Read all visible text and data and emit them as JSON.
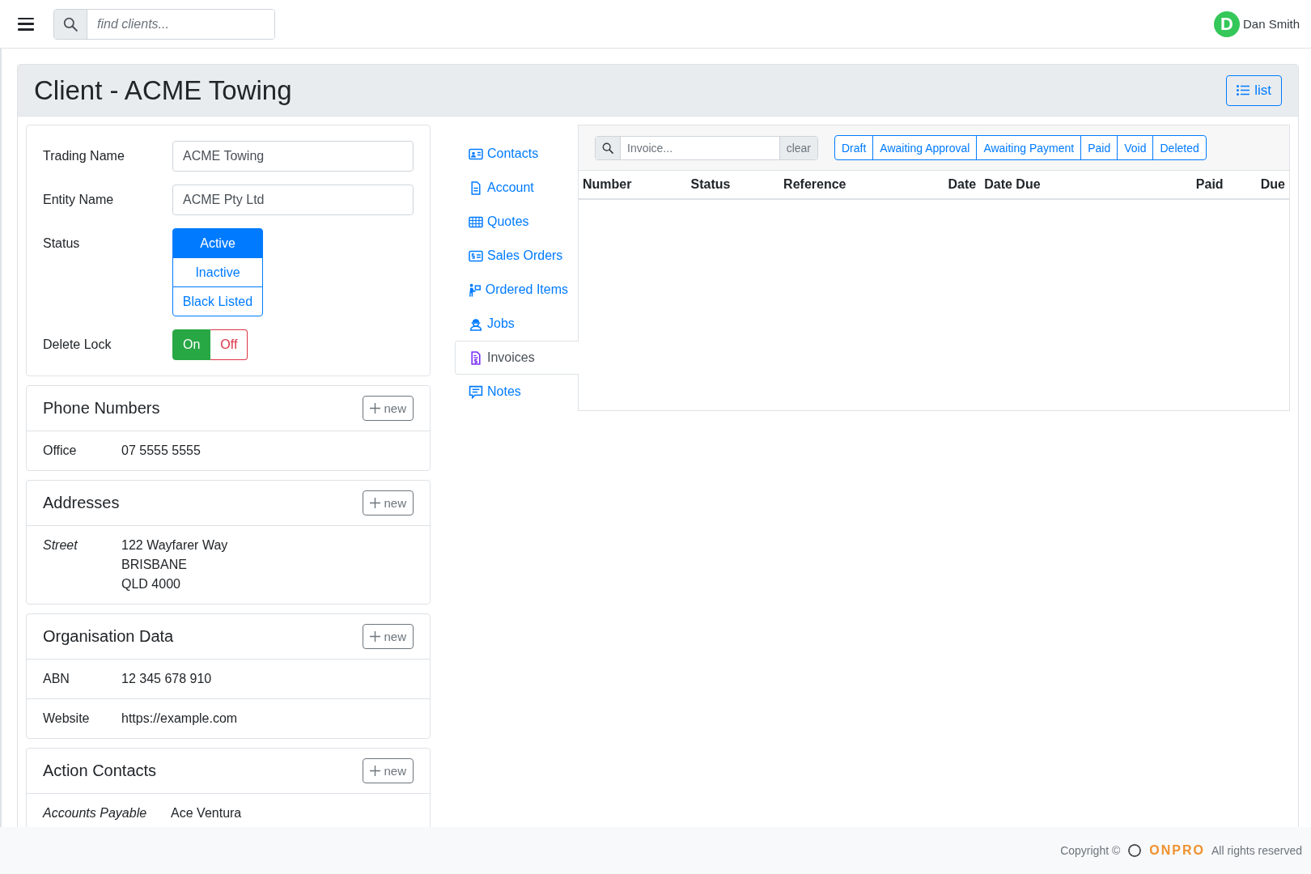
{
  "top_bar": {
    "search": {
      "placeholder": "find clients..."
    },
    "user": {
      "initial": "D",
      "name": "Dan Smith"
    }
  },
  "page": {
    "title": "Client - ACME Towing",
    "list_button": "list"
  },
  "details": {
    "fields": [
      {
        "label": "Trading Name",
        "value": "ACME Towing"
      },
      {
        "label": "Entity Name",
        "value": "ACME Pty Ltd"
      }
    ],
    "status": {
      "label": "Status",
      "options": [
        {
          "label": "Active",
          "selected": true
        },
        {
          "label": "Inactive",
          "selected": false
        },
        {
          "label": "Black Listed",
          "selected": false
        }
      ]
    },
    "delete_lock": {
      "label": "Delete Lock",
      "options": [
        {
          "label": "On",
          "selected": true
        },
        {
          "label": "Off",
          "selected": false
        }
      ]
    }
  },
  "sections": [
    {
      "title": "Phone Numbers",
      "new_button": "new",
      "rows": [
        {
          "label": "Office",
          "italic": false,
          "lines": [
            "07 5555 5555"
          ]
        }
      ]
    },
    {
      "title": "Addresses",
      "new_button": "new",
      "rows": [
        {
          "label": "Street",
          "italic": true,
          "lines": [
            "122 Wayfarer Way",
            "BRISBANE",
            "QLD 4000"
          ]
        }
      ]
    },
    {
      "title": "Organisation Data",
      "new_button": "new",
      "rows": [
        {
          "label": "ABN",
          "italic": false,
          "lines": [
            "12 345 678 910"
          ]
        },
        {
          "label": "Website",
          "italic": false,
          "lines": [
            "https://example.com"
          ]
        }
      ]
    },
    {
      "title": "Action Contacts",
      "new_button": "new",
      "rows": [
        {
          "label": "Accounts Payable",
          "italic": true,
          "lines": [
            "Ace Ventura"
          ]
        }
      ]
    }
  ],
  "tabs": [
    {
      "label": "Contacts",
      "selected": false
    },
    {
      "label": "Account",
      "selected": false
    },
    {
      "label": "Quotes",
      "selected": false
    },
    {
      "label": "Sales Orders",
      "selected": false
    },
    {
      "label": "Ordered Items",
      "selected": false
    },
    {
      "label": "Jobs",
      "selected": false
    },
    {
      "label": "Invoices",
      "selected": true
    },
    {
      "label": "Notes",
      "selected": false
    }
  ],
  "invoices": {
    "search": {
      "placeholder": "Invoice..."
    },
    "clear_button": "clear",
    "filters": [
      "Draft",
      "Awaiting Approval",
      "Awaiting Payment",
      "Paid",
      "Void",
      "Deleted"
    ],
    "columns": [
      "Number",
      "Status",
      "Reference",
      "Date",
      "Date Due",
      "Paid",
      "Due"
    ]
  },
  "footer": {
    "copyright": "Copyright ©",
    "logo": "ONPRO",
    "rights": "All rights reserved"
  }
}
